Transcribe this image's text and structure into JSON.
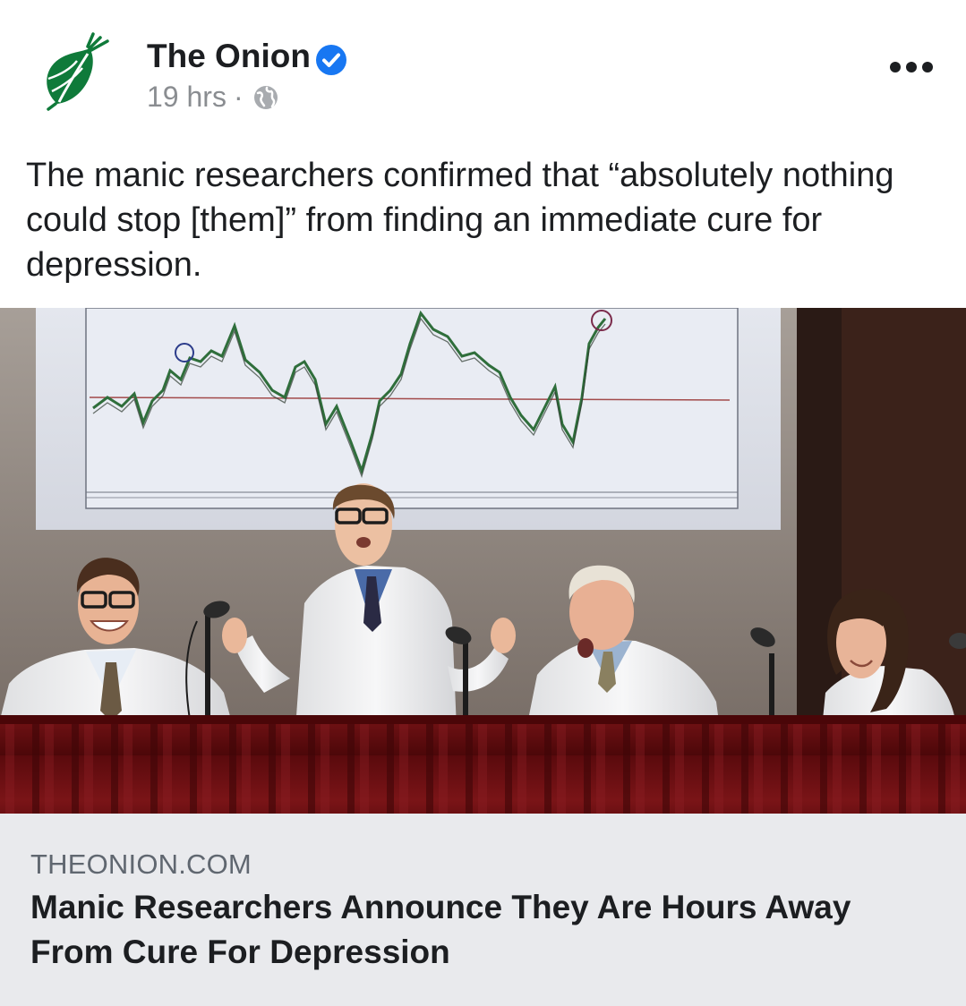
{
  "page": {
    "name": "The Onion",
    "verified": true,
    "time": "19 hrs",
    "separator": "·",
    "audience_icon": "globe-icon"
  },
  "post": {
    "text": "The manic researchers confirmed that “absolutely nothing could stop [them]” from finding an immediate cure for depression.",
    "image_description_icon": "photo"
  },
  "link": {
    "domain": "THEONION.COM",
    "title": "Manic Researchers Announce They Are Hours Away From Cure For Depression"
  },
  "colors": {
    "brand_green": "#0f7a3a",
    "verified_blue": "#1877f2",
    "card_background": "#e9eaed",
    "tablecloth": "#6e0f12"
  }
}
